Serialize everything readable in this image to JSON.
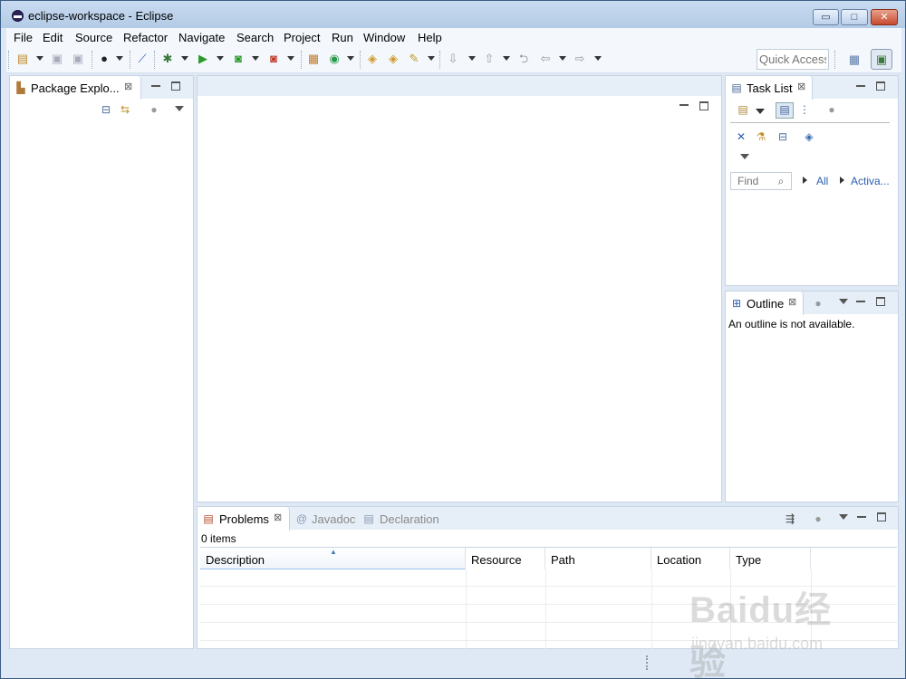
{
  "window": {
    "title": "eclipse-workspace - Eclipse",
    "controls": {
      "minimize": "▭",
      "maximize": "□",
      "close": "✕"
    }
  },
  "menu": [
    "File",
    "Edit",
    "Source",
    "Refactor",
    "Navigate",
    "Search",
    "Project",
    "Run",
    "Window",
    "Help"
  ],
  "toolbar": {
    "quick_access_label": "Quick Access",
    "icons": [
      "new-wizard-icon",
      "save-icon",
      "save-all-icon",
      "profile-icon",
      "skip-breakpoints-icon",
      "debug-icon",
      "run-icon",
      "coverage-icon",
      "external-tools-icon",
      "new-java-package-icon",
      "new-java-class-icon",
      "open-type-icon",
      "open-task-icon",
      "search-icon",
      "next-annotation-icon",
      "previous-annotation-icon",
      "last-edit-location-icon",
      "back-icon",
      "forward-icon",
      "open-perspective-icon",
      "java-perspective-icon"
    ]
  },
  "package_explorer": {
    "tab_label": "Package Explo...",
    "close_glyph": "⊠",
    "icons": [
      "collapse-all-icon",
      "link-with-editor-icon",
      "focus-active-task-icon",
      "view-menu-icon"
    ]
  },
  "task_list": {
    "tab_label": "Task List",
    "close_glyph": "⊠",
    "find_placeholder": "Find",
    "filter_all": "All",
    "filter_activate": "Activa...",
    "icons": [
      "new-task-icon",
      "categorized-icon",
      "scheduled-icon",
      "focus-icon",
      "hide-completed-icon",
      "show-unread-icon",
      "collapse-all-icon",
      "sync-icon"
    ]
  },
  "outline": {
    "tab_label": "Outline",
    "close_glyph": "⊠",
    "message": "An outline is not available."
  },
  "bottom_panel": {
    "tabs": [
      {
        "label": "Problems",
        "active": true
      },
      {
        "label": "Javadoc",
        "active": false
      },
      {
        "label": "Declaration",
        "active": false
      }
    ],
    "close_glyph": "⊠",
    "item_count": "0 items",
    "columns": [
      "Description",
      "Resource",
      "Path",
      "Location",
      "Type"
    ],
    "sorted_column": "Description"
  },
  "watermark": {
    "brand": "Baidu经验",
    "url": "jingyan.baidu.com"
  }
}
